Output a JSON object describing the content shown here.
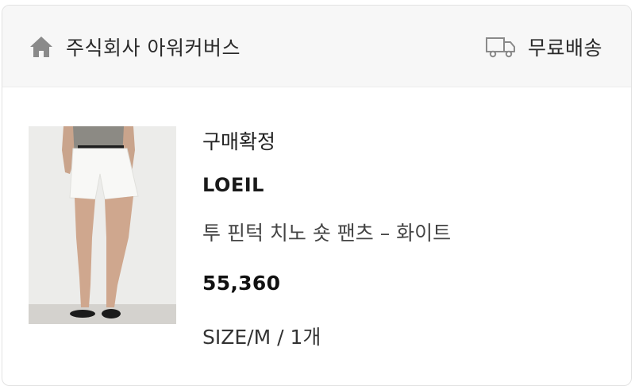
{
  "header": {
    "seller_name": "주식회사 아워커버스",
    "shipping_label": "무료배송"
  },
  "order": {
    "status": "구매확정",
    "brand": "LOEIL",
    "product_name": "투 핀턱 치노 숏 팬츠 – 화이트",
    "price": "55,360",
    "option": "SIZE/M / 1개"
  },
  "icons": {
    "home": "home-icon",
    "truck": "truck-icon"
  },
  "colors": {
    "header_bg": "#f7f7f7",
    "icon_gray": "#8a8a8a",
    "text": "#222222"
  }
}
